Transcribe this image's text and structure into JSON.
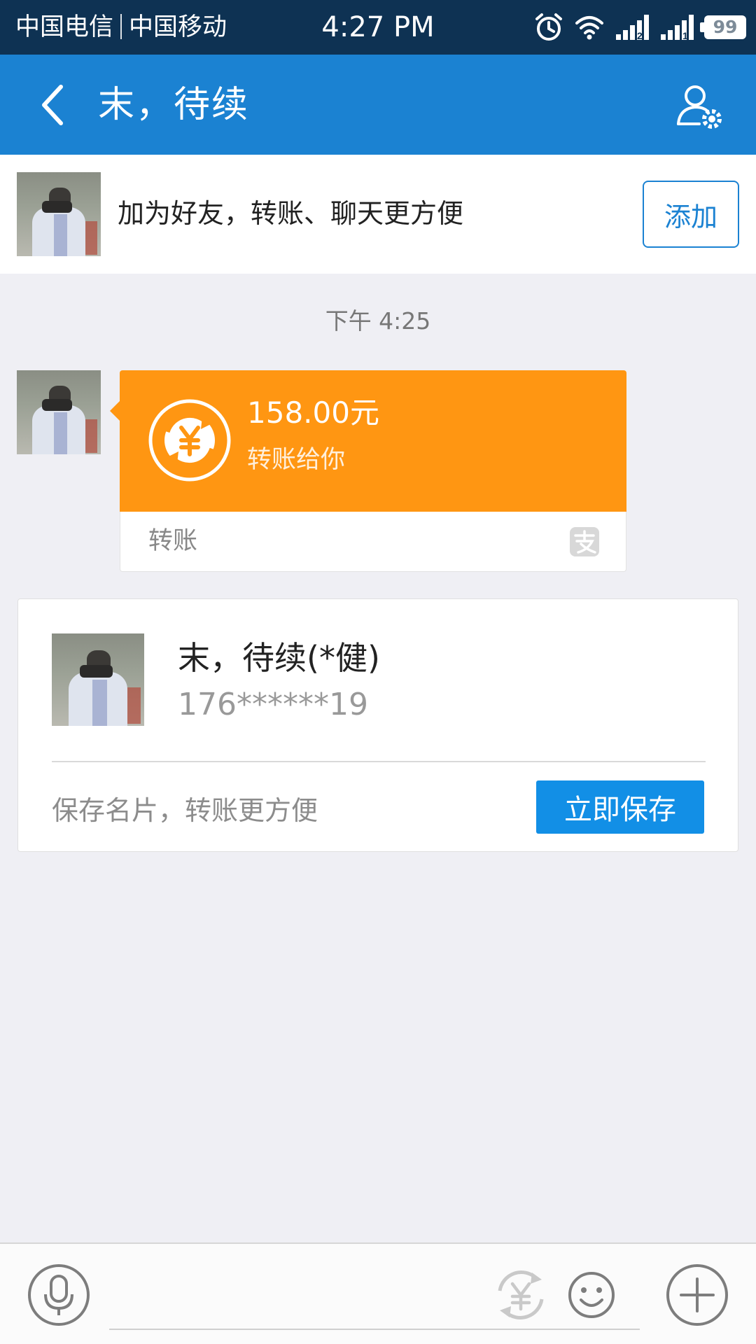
{
  "status_bar": {
    "carrier1": "中国电信",
    "carrier2": "中国移动",
    "time": "4:27 PM",
    "battery": "99",
    "icons": [
      "alarm-icon",
      "wifi-icon",
      "signal-2-icon",
      "signal-1-icon",
      "battery-icon"
    ]
  },
  "header": {
    "title": "末，待续",
    "back_icon": "chevron-left-icon",
    "profile_icon": "user-settings-icon"
  },
  "add_banner": {
    "text": "加为好友，转账、聊天更方便",
    "button": "添加"
  },
  "chat": {
    "timestamp": "下午 4:25",
    "transfer": {
      "amount": "158.00元",
      "description": "转账给你",
      "label": "转账",
      "icon": "yuan-transfer-icon",
      "brand_icon": "alipay-icon"
    }
  },
  "contact_card": {
    "name": "末，待续(*健)",
    "phone": "176******19",
    "hint": "保存名片，转账更方便",
    "button": "立即保存"
  },
  "input_bar": {
    "icons": [
      "microphone-icon",
      "yuan-transfer-icon",
      "emoji-icon",
      "plus-icon"
    ]
  },
  "colors": {
    "status_bar": "#0e3253",
    "header": "#1b82d2",
    "transfer": "#ff9612",
    "save_button": "#128fe6",
    "background": "#efeff4"
  }
}
